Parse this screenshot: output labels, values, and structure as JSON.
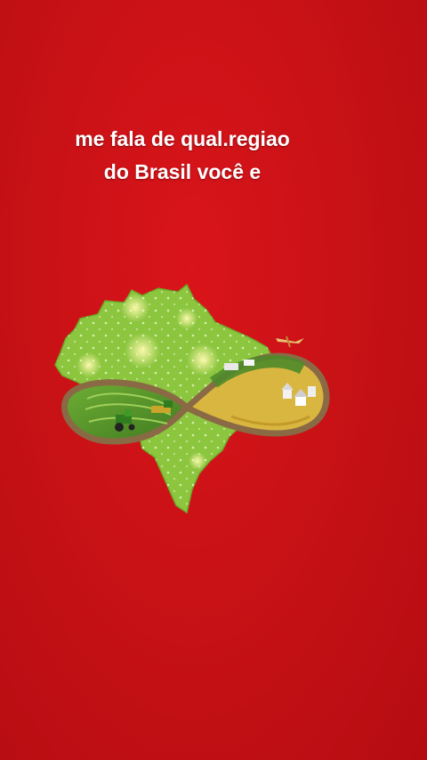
{
  "caption": {
    "line1": "me fala de qual.regiao",
    "line2": "do Brasil você e"
  },
  "colors": {
    "background": "#c91216",
    "text": "#ffffff",
    "map_fill": "#8cc63f",
    "field_dark": "#4e8b2a",
    "road": "#8a6a45"
  },
  "illustration": {
    "subject": "brazil-map-with-farm-infinity-road",
    "icons": [
      "brazil-map-icon",
      "tractor-icon",
      "farm-houses-icon",
      "airplane-icon"
    ]
  }
}
